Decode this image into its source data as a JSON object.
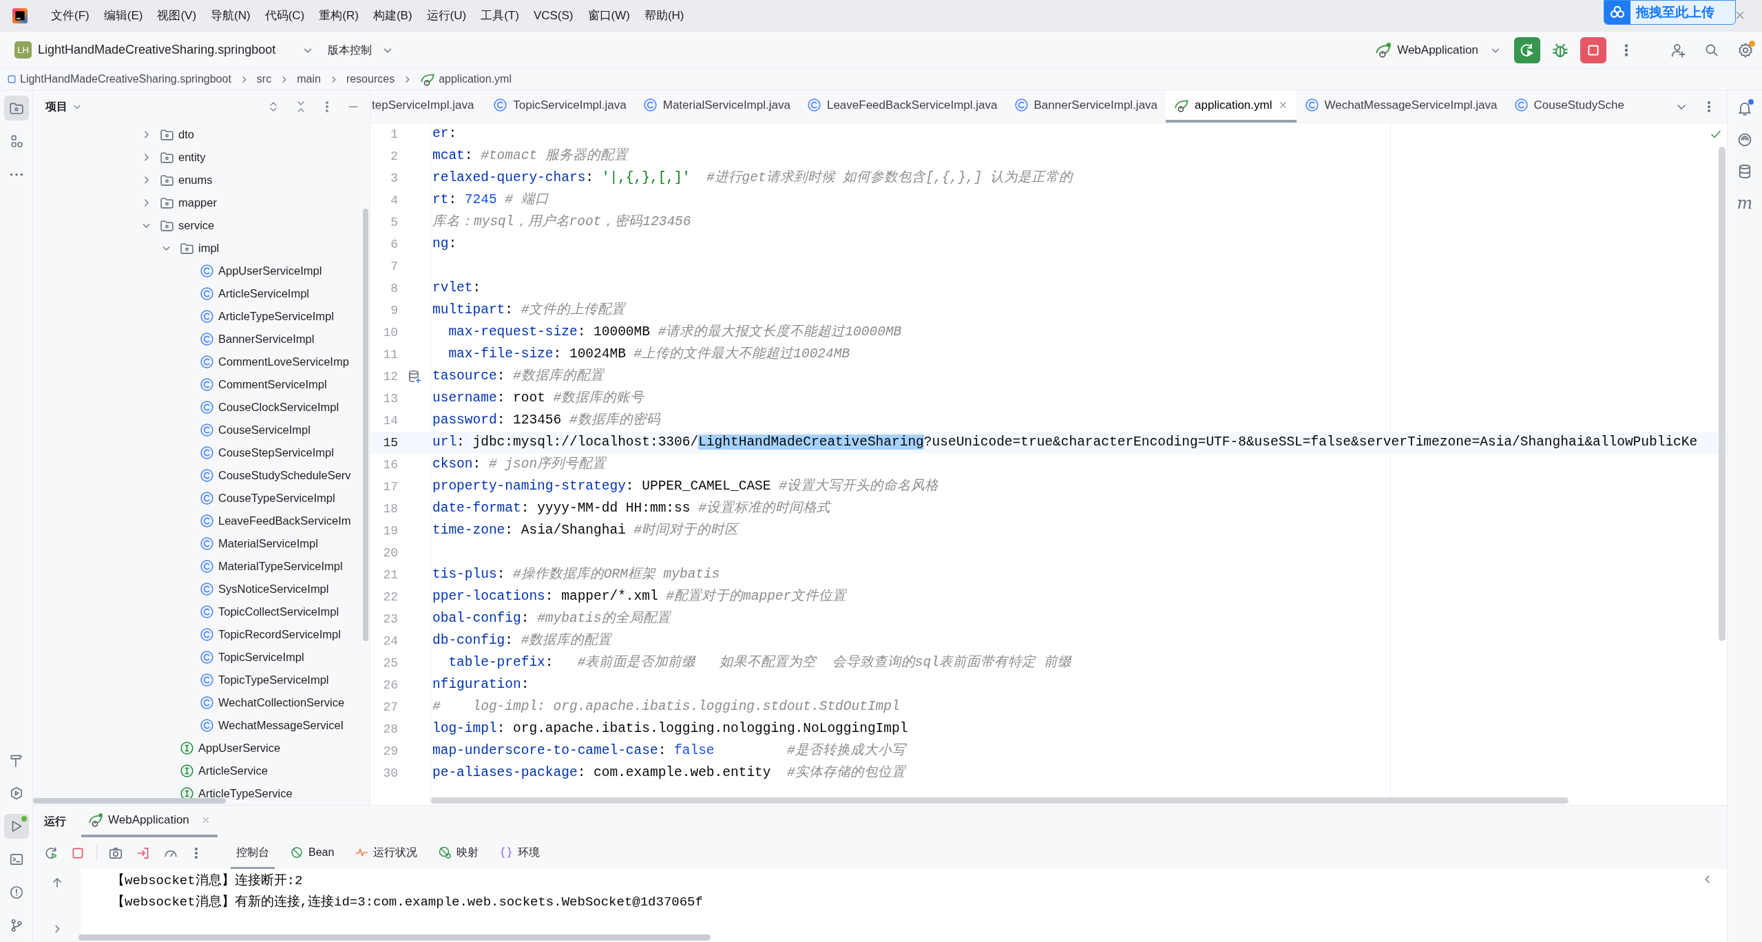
{
  "menu_bar": {
    "items": [
      "文件(F)",
      "编辑(E)",
      "视图(V)",
      "导航(N)",
      "代码(C)",
      "重构(R)",
      "构建(B)",
      "运行(U)",
      "工具(T)",
      "VCS(S)",
      "窗口(W)",
      "帮助(H)"
    ]
  },
  "upload_widget": {
    "label": "拖拽至此上传"
  },
  "toolbar": {
    "project_badge": "LH",
    "project": "LightHandMadeCreativeSharing.springboot",
    "vcs": "版本控制",
    "run_config": "WebApplication"
  },
  "breadcrumb": [
    {
      "kind": "module",
      "label": "LightHandMadeCreativeSharing.springboot"
    },
    {
      "kind": "folder",
      "label": "src"
    },
    {
      "kind": "folder",
      "label": "main"
    },
    {
      "kind": "folder",
      "label": "resources"
    },
    {
      "kind": "yaml",
      "label": "application.yml"
    }
  ],
  "left_strip": {
    "top": [
      {
        "kind": "project",
        "selected": true
      },
      {
        "kind": "structure",
        "selected": false
      },
      {
        "kind": "more",
        "selected": false
      }
    ],
    "bottom": [
      {
        "kind": "build",
        "selected": false
      },
      {
        "kind": "services",
        "selected": false
      },
      {
        "kind": "run",
        "selected": true
      },
      {
        "kind": "terminal",
        "selected": false
      },
      {
        "kind": "problems",
        "selected": false
      },
      {
        "kind": "git",
        "selected": false
      }
    ]
  },
  "right_strip": {
    "maven_label": "m"
  },
  "project_panel": {
    "title": "项目",
    "tree": [
      {
        "label": "dto",
        "kind": "folder",
        "expanded": false
      },
      {
        "label": "entity",
        "kind": "folder",
        "expanded": false
      },
      {
        "label": "enums",
        "kind": "folder",
        "expanded": false
      },
      {
        "label": "mapper",
        "kind": "folder",
        "expanded": false
      },
      {
        "label": "service",
        "kind": "folder",
        "expanded": true,
        "children": [
          {
            "label": "impl",
            "kind": "folder",
            "expanded": true,
            "children": [
              {
                "label": "AppUserServiceImpl",
                "kind": "class"
              },
              {
                "label": "ArticleServiceImpl",
                "kind": "class"
              },
              {
                "label": "ArticleTypeServiceImpl",
                "kind": "class"
              },
              {
                "label": "BannerServiceImpl",
                "kind": "class"
              },
              {
                "label": "CommentLoveServiceImp",
                "kind": "class"
              },
              {
                "label": "CommentServiceImpl",
                "kind": "class"
              },
              {
                "label": "CouseClockServiceImpl",
                "kind": "class"
              },
              {
                "label": "CouseServiceImpl",
                "kind": "class"
              },
              {
                "label": "CouseStepServiceImpl",
                "kind": "class"
              },
              {
                "label": "CouseStudyScheduleServ",
                "kind": "class"
              },
              {
                "label": "CouseTypeServiceImpl",
                "kind": "class"
              },
              {
                "label": "LeaveFeedBackServiceIm",
                "kind": "class"
              },
              {
                "label": "MaterialServiceImpl",
                "kind": "class"
              },
              {
                "label": "MaterialTypeServiceImpl",
                "kind": "class"
              },
              {
                "label": "SysNoticeServiceImpl",
                "kind": "class"
              },
              {
                "label": "TopicCollectServiceImpl",
                "kind": "class"
              },
              {
                "label": "TopicRecordServiceImpl",
                "kind": "class"
              },
              {
                "label": "TopicServiceImpl",
                "kind": "class"
              },
              {
                "label": "TopicTypeServiceImpl",
                "kind": "class"
              },
              {
                "label": "WechatCollectionService",
                "kind": "class"
              },
              {
                "label": "WechatMessageServiceI",
                "kind": "class"
              }
            ]
          },
          {
            "label": "AppUserService",
            "kind": "interface"
          },
          {
            "label": "ArticleService",
            "kind": "interface"
          },
          {
            "label": "ArticleTypeService",
            "kind": "interface"
          }
        ]
      }
    ]
  },
  "editor": {
    "tabs": [
      {
        "label": "tepServiceImpl.java",
        "kind": "plain",
        "selected": false
      },
      {
        "label": "TopicServiceImpl.java",
        "kind": "class",
        "selected": false
      },
      {
        "label": "MaterialServiceImpl.java",
        "kind": "class",
        "selected": false
      },
      {
        "label": "LeaveFeedBackServiceImpl.java",
        "kind": "class",
        "selected": false
      },
      {
        "label": "BannerServiceImpl.java",
        "kind": "class",
        "selected": false
      },
      {
        "label": "application.yml",
        "kind": "yaml",
        "selected": true
      },
      {
        "label": "WechatMessageServiceImpl.java",
        "kind": "class",
        "selected": false
      },
      {
        "label": "CouseStudySche",
        "kind": "class",
        "selected": false
      }
    ],
    "lines": [
      {
        "number": "1",
        "current": false,
        "gutter_marker": false,
        "segments": [
          {
            "kind": "key",
            "text": "er"
          },
          {
            "kind": "plain",
            "text": ":"
          }
        ]
      },
      {
        "number": "2",
        "current": false,
        "gutter_marker": false,
        "segments": [
          {
            "kind": "key",
            "text": "mcat"
          },
          {
            "kind": "plain",
            "text": ": "
          },
          {
            "kind": "comment",
            "text": "#tomact 服务器的配置"
          }
        ]
      },
      {
        "number": "3",
        "current": false,
        "gutter_marker": false,
        "segments": [
          {
            "kind": "key",
            "text": "relaxed-query-chars"
          },
          {
            "kind": "plain",
            "text": ": "
          },
          {
            "kind": "string",
            "text": "'|,{,},[,]'"
          },
          {
            "kind": "comment",
            "text": "  #进行get请求到时候 如何参数包含[,{,},] 认为是正常的"
          }
        ]
      },
      {
        "number": "4",
        "current": false,
        "gutter_marker": false,
        "segments": [
          {
            "kind": "key",
            "text": "rt"
          },
          {
            "kind": "plain",
            "text": ": "
          },
          {
            "kind": "number",
            "text": "7245"
          },
          {
            "kind": "comment",
            "text": " # 端口"
          }
        ]
      },
      {
        "number": "5",
        "current": false,
        "gutter_marker": false,
        "segments": [
          {
            "kind": "comment",
            "text": "库名：mysql，用户名root，密码123456"
          }
        ]
      },
      {
        "number": "6",
        "current": false,
        "gutter_marker": false,
        "segments": [
          {
            "kind": "key",
            "text": "ng"
          },
          {
            "kind": "plain",
            "text": ":"
          }
        ]
      },
      {
        "number": "7",
        "current": false,
        "gutter_marker": false
      },
      {
        "number": "8",
        "current": false,
        "gutter_marker": false,
        "segments": [
          {
            "kind": "key",
            "text": "rvlet"
          },
          {
            "kind": "plain",
            "text": ":"
          }
        ]
      },
      {
        "number": "9",
        "current": false,
        "gutter_marker": false,
        "segments": [
          {
            "kind": "key",
            "text": "multipart"
          },
          {
            "kind": "plain",
            "text": ": "
          },
          {
            "kind": "comment",
            "text": "#文件的上传配置"
          }
        ]
      },
      {
        "number": "10",
        "current": false,
        "gutter_marker": false,
        "segments": [
          {
            "kind": "key",
            "text": "  max-request-size"
          },
          {
            "kind": "plain",
            "text": ": 10000MB "
          },
          {
            "kind": "comment",
            "text": "#请求的最大报文长度不能超过10000MB"
          }
        ]
      },
      {
        "number": "11",
        "current": false,
        "gutter_marker": false,
        "segments": [
          {
            "kind": "key",
            "text": "  max-file-size"
          },
          {
            "kind": "plain",
            "text": ": 10024MB "
          },
          {
            "kind": "comment",
            "text": "#上传的文件最大不能超过10024MB"
          }
        ]
      },
      {
        "number": "12",
        "current": false,
        "gutter_marker": true,
        "segments": [
          {
            "kind": "key",
            "text": "tasource"
          },
          {
            "kind": "plain",
            "text": ": "
          },
          {
            "kind": "comment",
            "text": "#数据库的配置"
          }
        ]
      },
      {
        "number": "13",
        "current": false,
        "gutter_marker": false,
        "segments": [
          {
            "kind": "key",
            "text": "username"
          },
          {
            "kind": "plain",
            "text": ": root "
          },
          {
            "kind": "comment",
            "text": "#数据库的账号"
          }
        ]
      },
      {
        "number": "14",
        "current": false,
        "gutter_marker": false,
        "segments": [
          {
            "kind": "key",
            "text": "password"
          },
          {
            "kind": "plain",
            "text": ": 123456 "
          },
          {
            "kind": "comment",
            "text": "#数据库的密码"
          }
        ]
      },
      {
        "number": "15",
        "current": true,
        "gutter_marker": false,
        "segments": [
          {
            "kind": "key",
            "text": "url"
          },
          {
            "kind": "plain",
            "text": ": jdbc:mysql://localhost:3306/"
          },
          {
            "kind": "selection",
            "text": "LightHandMadeCreativeSharing"
          },
          {
            "kind": "plain",
            "text": "?useUnicode=true&characterEncoding=UTF-8&useSSL=false&serverTimezone=Asia/Shanghai&allowPublicKe"
          }
        ]
      },
      {
        "number": "16",
        "current": false,
        "gutter_marker": false,
        "segments": [
          {
            "kind": "key",
            "text": "ckson"
          },
          {
            "kind": "plain",
            "text": ": "
          },
          {
            "kind": "comment",
            "text": "# json序列号配置"
          }
        ]
      },
      {
        "number": "17",
        "current": false,
        "gutter_marker": false,
        "segments": [
          {
            "kind": "key",
            "text": "property-naming-strategy"
          },
          {
            "kind": "plain",
            "text": ": UPPER_CAMEL_CASE "
          },
          {
            "kind": "comment",
            "text": "#设置大写开头的命名风格"
          }
        ]
      },
      {
        "number": "18",
        "current": false,
        "gutter_marker": false,
        "segments": [
          {
            "kind": "key",
            "text": "date-format"
          },
          {
            "kind": "plain",
            "text": ": yyyy-MM-dd HH:mm:ss "
          },
          {
            "kind": "comment",
            "text": "#设置标准的时间格式"
          }
        ]
      },
      {
        "number": "19",
        "current": false,
        "gutter_marker": false,
        "segments": [
          {
            "kind": "key",
            "text": "time-zone"
          },
          {
            "kind": "plain",
            "text": ": Asia/Shanghai "
          },
          {
            "kind": "comment",
            "text": "#时间对于的时区"
          }
        ]
      },
      {
        "number": "20",
        "current": false,
        "gutter_marker": false
      },
      {
        "number": "21",
        "current": false,
        "gutter_marker": false,
        "segments": [
          {
            "kind": "key",
            "text": "tis-plus"
          },
          {
            "kind": "plain",
            "text": ": "
          },
          {
            "kind": "comment",
            "text": "#操作数据库的ORM框架 mybatis"
          }
        ]
      },
      {
        "number": "22",
        "current": false,
        "gutter_marker": false,
        "segments": [
          {
            "kind": "key",
            "text": "pper-locations"
          },
          {
            "kind": "plain",
            "text": ": mapper/*.xml "
          },
          {
            "kind": "comment",
            "text": "#配置对于的mapper文件位置"
          }
        ]
      },
      {
        "number": "23",
        "current": false,
        "gutter_marker": false,
        "segments": [
          {
            "kind": "key",
            "text": "obal-config"
          },
          {
            "kind": "plain",
            "text": ": "
          },
          {
            "kind": "comment",
            "text": "#mybatis的全局配置"
          }
        ]
      },
      {
        "number": "24",
        "current": false,
        "gutter_marker": false,
        "segments": [
          {
            "kind": "key",
            "text": "db-config"
          },
          {
            "kind": "plain",
            "text": ": "
          },
          {
            "kind": "comment",
            "text": "#数据库的配置"
          }
        ]
      },
      {
        "number": "25",
        "current": false,
        "gutter_marker": false,
        "segments": [
          {
            "kind": "key",
            "text": "  table-prefix"
          },
          {
            "kind": "plain",
            "text": ":   "
          },
          {
            "kind": "comment",
            "text": "#表前面是否加前缀   如果不配置为空  会导致查询的sql表前面带有特定 前缀"
          }
        ]
      },
      {
        "number": "26",
        "current": false,
        "gutter_marker": false,
        "segments": [
          {
            "kind": "key",
            "text": "nfiguration"
          },
          {
            "kind": "plain",
            "text": ":"
          }
        ]
      },
      {
        "number": "27",
        "current": false,
        "gutter_marker": false,
        "segments": [
          {
            "kind": "comment",
            "text": "#    log-impl: org.apache.ibatis.logging.stdout.StdOutImpl"
          }
        ]
      },
      {
        "number": "28",
        "current": false,
        "gutter_marker": false,
        "segments": [
          {
            "kind": "key",
            "text": "log-impl"
          },
          {
            "kind": "plain",
            "text": ": org.apache.ibatis.logging.nologging.NoLoggingImpl"
          }
        ]
      },
      {
        "number": "29",
        "current": false,
        "gutter_marker": false,
        "segments": [
          {
            "kind": "key",
            "text": "map-underscore-to-camel-case"
          },
          {
            "kind": "plain",
            "text": ": "
          },
          {
            "kind": "keyword",
            "text": "false"
          },
          {
            "kind": "comment",
            "text": "         #是否转换成大小写"
          }
        ]
      },
      {
        "number": "30",
        "current": false,
        "gutter_marker": false,
        "segments": [
          {
            "kind": "key",
            "text": "pe-aliases-package"
          },
          {
            "kind": "plain",
            "text": ": com.example.web.entity  "
          },
          {
            "kind": "comment",
            "text": "#实体存储的包位置"
          }
        ]
      }
    ]
  },
  "run_panel": {
    "title": "运行",
    "tabs": [
      {
        "label": "WebApplication",
        "selected": true
      }
    ],
    "toolbar_tabs": [
      {
        "label": "控制台",
        "kind": "console",
        "selected": true
      },
      {
        "label": "Bean",
        "kind": "bean",
        "selected": false
      },
      {
        "label": "运行状况",
        "kind": "health",
        "selected": false
      },
      {
        "label": "映射",
        "kind": "mappings",
        "selected": false
      },
      {
        "label": "环境",
        "kind": "environment",
        "selected": false
      }
    ],
    "console": [
      "【websocket消息】连接断开:2",
      "【websocket消息】有新的连接,连接id=3:com.example.web.sockets.WebSocket@1d37065f"
    ]
  }
}
